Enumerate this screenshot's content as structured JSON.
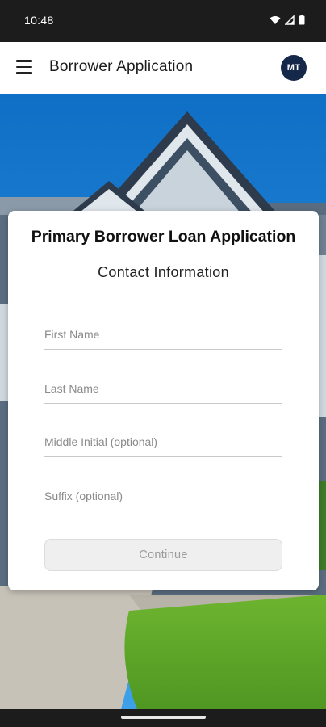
{
  "status_bar": {
    "time": "10:48",
    "icons": [
      "wifi-icon",
      "signal-icon",
      "battery-icon"
    ]
  },
  "app_bar": {
    "menu_icon": "hamburger-menu-icon",
    "title": "Borrower Application",
    "avatar_initials": "MT"
  },
  "form": {
    "title": "Primary Borrower Loan Application",
    "section": "Contact Information",
    "fields": [
      {
        "placeholder": "First Name",
        "value": ""
      },
      {
        "placeholder": "Last Name",
        "value": ""
      },
      {
        "placeholder": "Middle Initial (optional)",
        "value": ""
      },
      {
        "placeholder": "Suffix (optional)",
        "value": ""
      }
    ],
    "continue_label": "Continue"
  },
  "colors": {
    "avatar_bg": "#16284a",
    "sky": "#1e88d6",
    "lawn": "#5fa62a",
    "button_disabled_bg": "#efefef",
    "button_disabled_text": "#9b9b9b"
  }
}
